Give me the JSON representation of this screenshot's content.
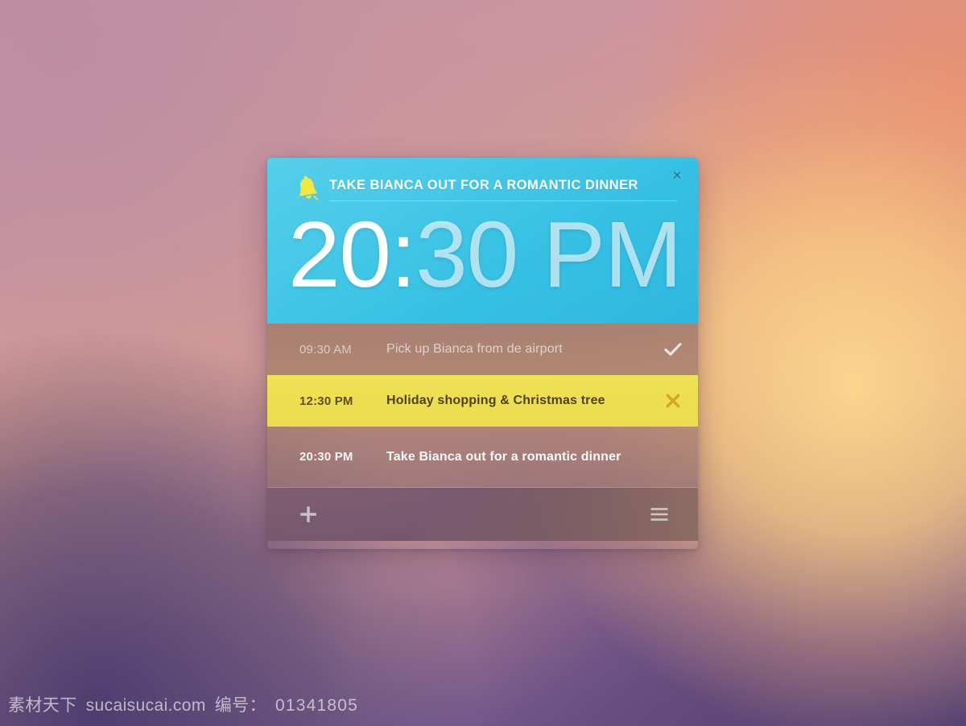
{
  "wallpaper": {
    "gradient_colors": [
      "#bd8fa2",
      "#e09478",
      "#fad18a",
      "#4c3e6d",
      "#7d6096"
    ]
  },
  "alarm_card": {
    "accent_color": "#3cc3e5",
    "header": {
      "bell_icon": "bell-icon",
      "title": "TAKE BIANCA OUT FOR A ROMANTIC DINNER",
      "close_label": "×",
      "clock_hours": "20:",
      "clock_rest": "30 PM",
      "full_time": "20:30 PM"
    },
    "tasks": [
      {
        "time": "09:30 AM",
        "label": "Pick up Bianca from de airport",
        "state": "done",
        "action_icon": "check-icon",
        "row_color": "#a67e70"
      },
      {
        "time": "12:30 PM",
        "label": "Holiday shopping & Christmas tree",
        "state": "highlighted",
        "action_icon": "cross-icon",
        "row_color": "#efe155"
      },
      {
        "time": "20:30 PM",
        "label": "Take Bianca out for a romantic dinner",
        "state": "normal",
        "action_icon": "",
        "row_color": "#a47c70"
      }
    ],
    "footer": {
      "add_icon": "plus-icon",
      "menu_icon": "hamburger-menu-icon"
    }
  },
  "watermark": {
    "site_label": "素材天下",
    "domain": "sucaisucai.com",
    "id_label": "编号：",
    "id_number": "01341805"
  }
}
